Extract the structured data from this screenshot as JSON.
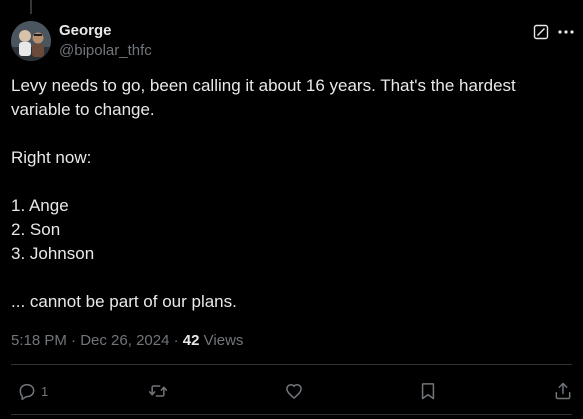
{
  "author": {
    "name": "George",
    "handle": "@bipolar_thfc"
  },
  "tweet": {
    "lines": [
      "Levy needs to go, been calling it about 16 years. That's the hardest variable to change.",
      "",
      "Right now:",
      "",
      "1. Ange",
      "2. Son",
      "3. Johnson",
      "",
      "... cannot be part of our plans."
    ]
  },
  "meta": {
    "time": "5:18 PM",
    "separator": "·",
    "date": "Dec 26, 2024",
    "views_count": "42",
    "views_label": "Views"
  },
  "actions": {
    "reply_count": "1"
  },
  "icons": {
    "grok": "grok-icon",
    "more": "more-icon",
    "reply": "reply-icon",
    "repost": "repost-icon",
    "like": "like-icon",
    "bookmark": "bookmark-icon",
    "share": "share-icon"
  },
  "colors": {
    "background": "#000000",
    "text": "#e7e9ea",
    "secondary": "#71767b",
    "divider": "#2f3336"
  }
}
